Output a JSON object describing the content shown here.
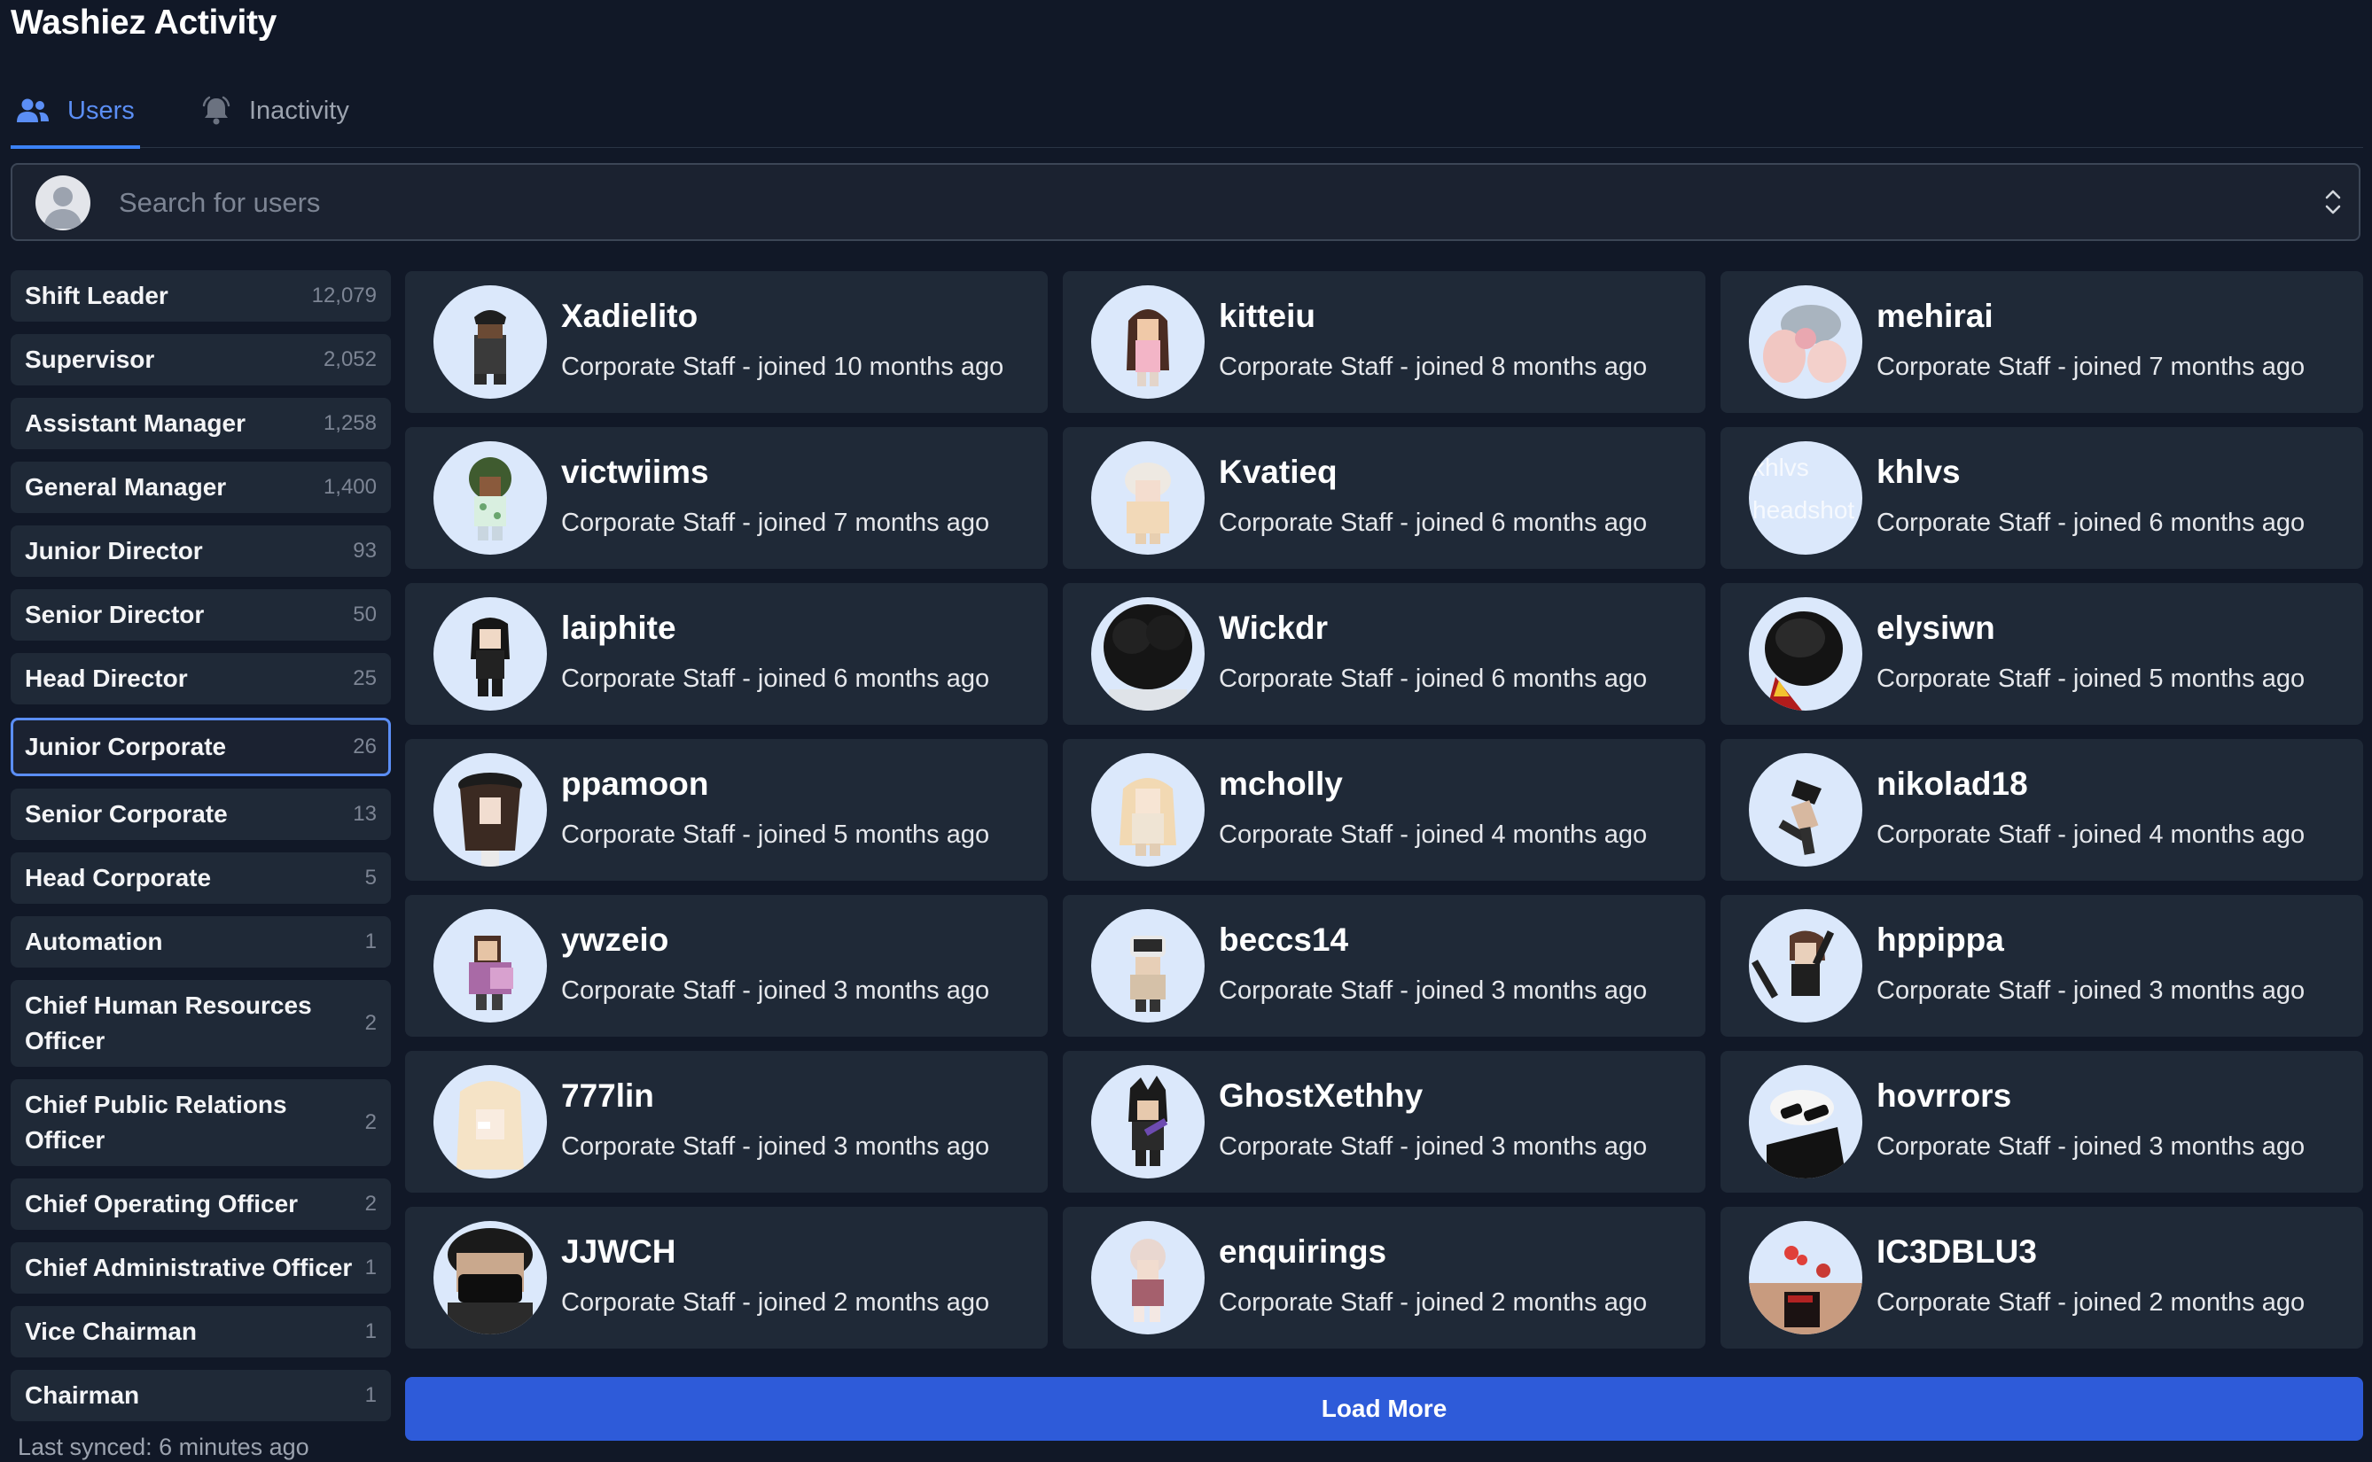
{
  "app_title": "Washiez Activity",
  "tabs": [
    {
      "label": "Users",
      "icon": "users-icon",
      "active": true
    },
    {
      "label": "Inactivity",
      "icon": "bell-icon",
      "active": false
    }
  ],
  "search": {
    "placeholder": "Search for users",
    "value": ""
  },
  "roles": [
    {
      "label": "Shift Leader",
      "count": "12,079"
    },
    {
      "label": "Supervisor",
      "count": "2,052"
    },
    {
      "label": "Assistant Manager",
      "count": "1,258"
    },
    {
      "label": "General Manager",
      "count": "1,400"
    },
    {
      "label": "Junior Director",
      "count": "93"
    },
    {
      "label": "Senior Director",
      "count": "50"
    },
    {
      "label": "Head Director",
      "count": "25"
    },
    {
      "label": "Junior Corporate",
      "count": "26",
      "selected": true
    },
    {
      "label": "Senior Corporate",
      "count": "13"
    },
    {
      "label": "Head Corporate",
      "count": "5"
    },
    {
      "label": "Automation",
      "count": "1"
    },
    {
      "label": "Chief Human Resources Officer",
      "count": "2"
    },
    {
      "label": "Chief Public Relations Officer",
      "count": "2"
    },
    {
      "label": "Chief Operating Officer",
      "count": "2"
    },
    {
      "label": "Chief Administrative Officer",
      "count": "1"
    },
    {
      "label": "Vice Chairman",
      "count": "1"
    },
    {
      "label": "Chairman",
      "count": "1"
    }
  ],
  "last_synced": "Last synced: 6 minutes ago",
  "users": [
    {
      "name": "Xadielito",
      "meta": "Corporate Staff - joined 10 months ago"
    },
    {
      "name": "kitteiu",
      "meta": "Corporate Staff - joined 8 months ago"
    },
    {
      "name": "mehirai",
      "meta": "Corporate Staff - joined 7 months ago"
    },
    {
      "name": "victwiims",
      "meta": "Corporate Staff - joined 7 months ago"
    },
    {
      "name": "Kvatieq",
      "meta": "Corporate Staff - joined 6 months ago"
    },
    {
      "name": "khlvs",
      "meta": "Corporate Staff - joined 6 months ago",
      "broken_avatar_alt": "khlvs headshot"
    },
    {
      "name": "laiphite",
      "meta": "Corporate Staff - joined 6 months ago"
    },
    {
      "name": "Wickdr",
      "meta": "Corporate Staff - joined 6 months ago"
    },
    {
      "name": "elysiwn",
      "meta": "Corporate Staff - joined 5 months ago"
    },
    {
      "name": "ppamoon",
      "meta": "Corporate Staff - joined 5 months ago"
    },
    {
      "name": "mcholly",
      "meta": "Corporate Staff - joined 4 months ago"
    },
    {
      "name": "nikolad18",
      "meta": "Corporate Staff - joined 4 months ago"
    },
    {
      "name": "ywzeio",
      "meta": "Corporate Staff - joined 3 months ago"
    },
    {
      "name": "beccs14",
      "meta": "Corporate Staff - joined 3 months ago"
    },
    {
      "name": "hppippa",
      "meta": "Corporate Staff - joined 3 months ago"
    },
    {
      "name": "777lin",
      "meta": "Corporate Staff - joined 3 months ago"
    },
    {
      "name": "GhostXethhy",
      "meta": "Corporate Staff - joined 3 months ago"
    },
    {
      "name": "hovrrors",
      "meta": "Corporate Staff - joined 3 months ago"
    },
    {
      "name": "JJWCH",
      "meta": "Corporate Staff - joined 2 months ago"
    },
    {
      "name": "enquirings",
      "meta": "Corporate Staff - joined 2 months ago"
    },
    {
      "name": "IC3DBLU3",
      "meta": "Corporate Staff - joined 2 months ago"
    }
  ],
  "load_more_label": "Load More",
  "colors": {
    "accent": "#3b82f6",
    "button": "#2e5bd9",
    "card": "#1f2937",
    "background": "#111827"
  }
}
